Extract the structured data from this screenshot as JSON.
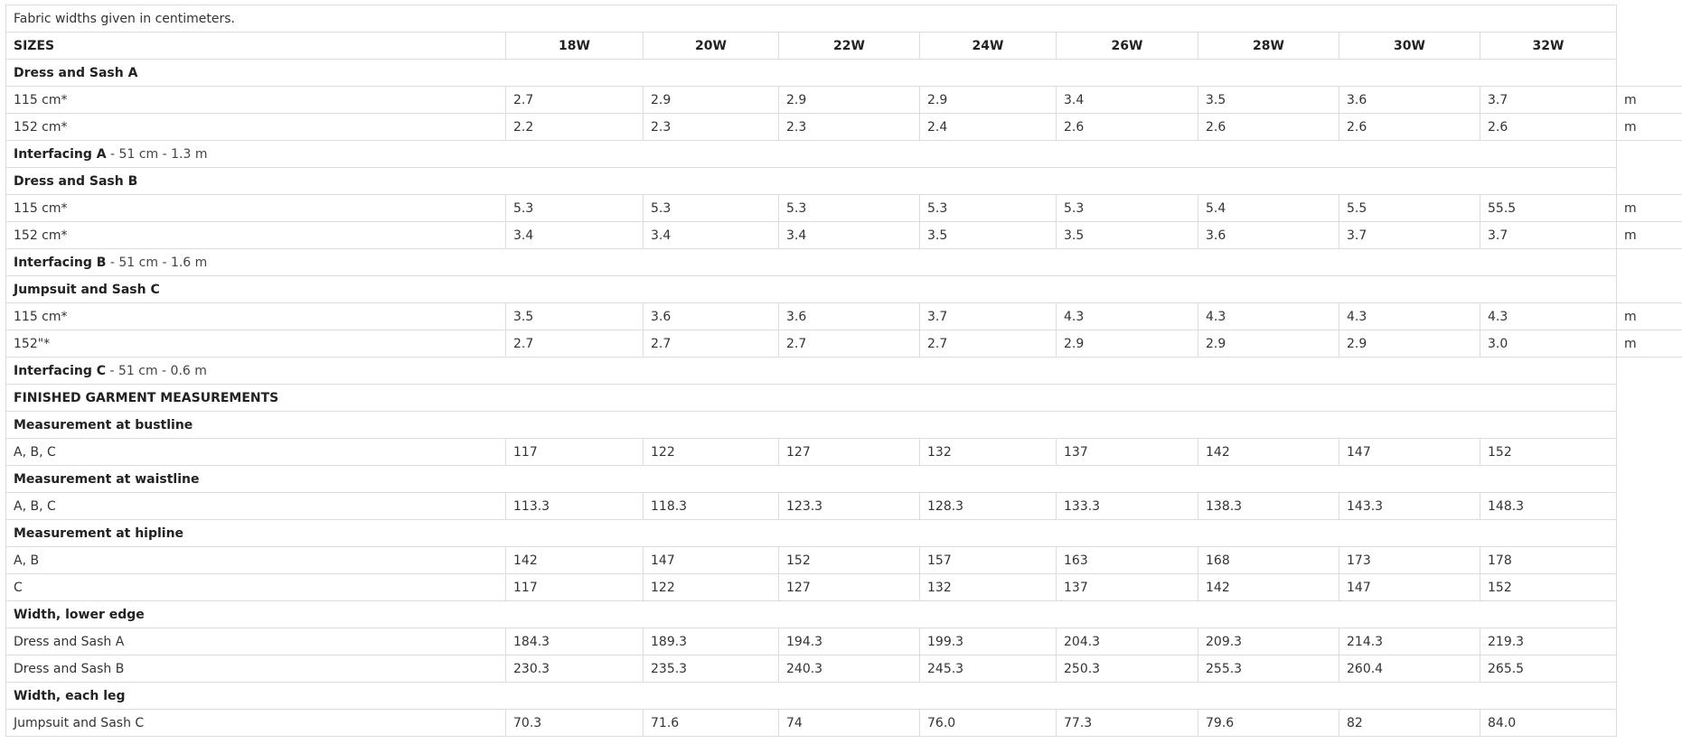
{
  "note": "Fabric widths given in centimeters.",
  "sizes_label": "SIZES",
  "sizes": [
    "18W",
    "20W",
    "22W",
    "24W",
    "26W",
    "28W",
    "30W",
    "32W"
  ],
  "rows": [
    {
      "type": "section",
      "label": "Dress and Sash A"
    },
    {
      "type": "data",
      "label": "115 cm*",
      "values": [
        "2.7",
        "2.9",
        "2.9",
        "2.9",
        "3.4",
        "3.5",
        "3.6",
        "3.7"
      ],
      "unit": "m"
    },
    {
      "type": "data",
      "label": "152 cm*",
      "values": [
        "2.2",
        "2.3",
        "2.3",
        "2.4",
        "2.6",
        "2.6",
        "2.6",
        "2.6"
      ],
      "unit": "m"
    },
    {
      "type": "note",
      "label": "Interfacing A",
      "suffix": " - 51 cm - 1.3 m"
    },
    {
      "type": "section",
      "label": "Dress and Sash B"
    },
    {
      "type": "data",
      "label": "115 cm*",
      "values": [
        "5.3",
        "5.3",
        "5.3",
        "5.3",
        "5.3",
        "5.4",
        "5.5",
        "55.5"
      ],
      "unit": "m"
    },
    {
      "type": "data",
      "label": "152 cm*",
      "values": [
        "3.4",
        "3.4",
        "3.4",
        "3.5",
        "3.5",
        "3.6",
        "3.7",
        "3.7"
      ],
      "unit": "m"
    },
    {
      "type": "note",
      "label": "Interfacing B",
      "suffix": " - 51 cm - 1.6 m"
    },
    {
      "type": "section",
      "label": "Jumpsuit and Sash C"
    },
    {
      "type": "data",
      "label": "115 cm*",
      "values": [
        "3.5",
        "3.6",
        "3.6",
        "3.7",
        "4.3",
        "4.3",
        "4.3",
        "4.3"
      ],
      "unit": "m"
    },
    {
      "type": "data",
      "label": "152\"*",
      "values": [
        "2.7",
        "2.7",
        "2.7",
        "2.7",
        "2.9",
        "2.9",
        "2.9",
        "3.0"
      ],
      "unit": "m"
    },
    {
      "type": "note",
      "label": "Interfacing C",
      "suffix": " - 51 cm - 0.6 m"
    },
    {
      "type": "section",
      "label": "FINISHED GARMENT MEASUREMENTS"
    },
    {
      "type": "section",
      "label": "Measurement at bustline"
    },
    {
      "type": "data",
      "label": "A, B, C",
      "values": [
        "117",
        "122",
        "127",
        "132",
        "137",
        "142",
        "147",
        "152"
      ],
      "unit": ""
    },
    {
      "type": "section",
      "label": "Measurement at waistline"
    },
    {
      "type": "data",
      "label": "A, B, C",
      "values": [
        "113.3",
        "118.3",
        "123.3",
        "128.3",
        "133.3",
        "138.3",
        "143.3",
        "148.3"
      ],
      "unit": ""
    },
    {
      "type": "section",
      "label": "Measurement at hipline"
    },
    {
      "type": "data",
      "label": "A, B",
      "values": [
        "142",
        "147",
        "152",
        "157",
        "163",
        "168",
        "173",
        "178"
      ],
      "unit": ""
    },
    {
      "type": "data",
      "label": "C",
      "values": [
        "117",
        "122",
        "127",
        "132",
        "137",
        "142",
        "147",
        "152"
      ],
      "unit": ""
    },
    {
      "type": "section",
      "label": "Width, lower edge"
    },
    {
      "type": "data",
      "label": "Dress and Sash A",
      "values": [
        "184.3",
        "189.3",
        "194.3",
        "199.3",
        "204.3",
        "209.3",
        "214.3",
        "219.3"
      ],
      "unit": ""
    },
    {
      "type": "data",
      "label": "Dress and Sash B",
      "values": [
        "230.3",
        "235.3",
        "240.3",
        "245.3",
        "250.3",
        "255.3",
        "260.4",
        "265.5"
      ],
      "unit": ""
    },
    {
      "type": "section",
      "label": "Width, each leg"
    },
    {
      "type": "data",
      "label": "Jumpsuit and Sash C",
      "values": [
        "70.3",
        "71.6",
        "74",
        "76.0",
        "77.3",
        "79.6",
        "82",
        "84.0"
      ],
      "unit": ""
    }
  ]
}
